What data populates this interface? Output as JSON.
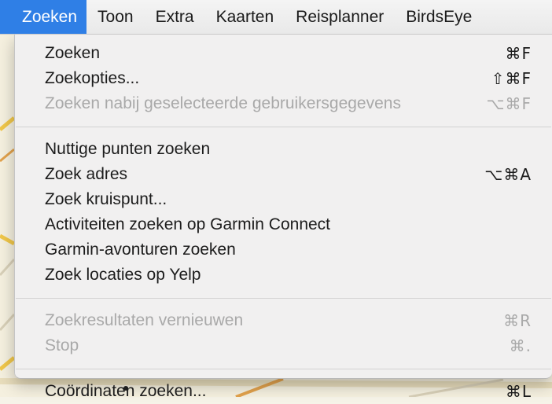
{
  "menubar": {
    "items": [
      {
        "label": "Zoeken",
        "active": true
      },
      {
        "label": "Toon",
        "active": false
      },
      {
        "label": "Extra",
        "active": false
      },
      {
        "label": "Kaarten",
        "active": false
      },
      {
        "label": "Reisplanner",
        "active": false
      },
      {
        "label": "BirdsEye",
        "active": false
      }
    ]
  },
  "menu": {
    "groups": [
      {
        "items": [
          {
            "label": "Zoeken",
            "shortcut": "⌘F",
            "enabled": true
          },
          {
            "label": "Zoekopties...",
            "shortcut": "⇧⌘F",
            "enabled": true
          },
          {
            "label": "Zoeken nabij geselecteerde gebruikersgegevens",
            "shortcut": "⌥⌘F",
            "enabled": false
          }
        ]
      },
      {
        "items": [
          {
            "label": "Nuttige punten zoeken",
            "shortcut": "",
            "enabled": true
          },
          {
            "label": "Zoek adres",
            "shortcut": "⌥⌘A",
            "enabled": true
          },
          {
            "label": "Zoek kruispunt...",
            "shortcut": "",
            "enabled": true
          },
          {
            "label": "Activiteiten zoeken op Garmin Connect",
            "shortcut": "",
            "enabled": true
          },
          {
            "label": "Garmin-avonturen zoeken",
            "shortcut": "",
            "enabled": true
          },
          {
            "label": "Zoek locaties op Yelp",
            "shortcut": "",
            "enabled": true
          }
        ]
      },
      {
        "items": [
          {
            "label": "Zoekresultaten vernieuwen",
            "shortcut": "⌘R",
            "enabled": false
          },
          {
            "label": "Stop",
            "shortcut": "⌘.",
            "enabled": false
          }
        ]
      },
      {
        "items": [
          {
            "label": "Coördinaten zoeken...",
            "shortcut": "⌘L",
            "enabled": true
          }
        ]
      }
    ]
  }
}
